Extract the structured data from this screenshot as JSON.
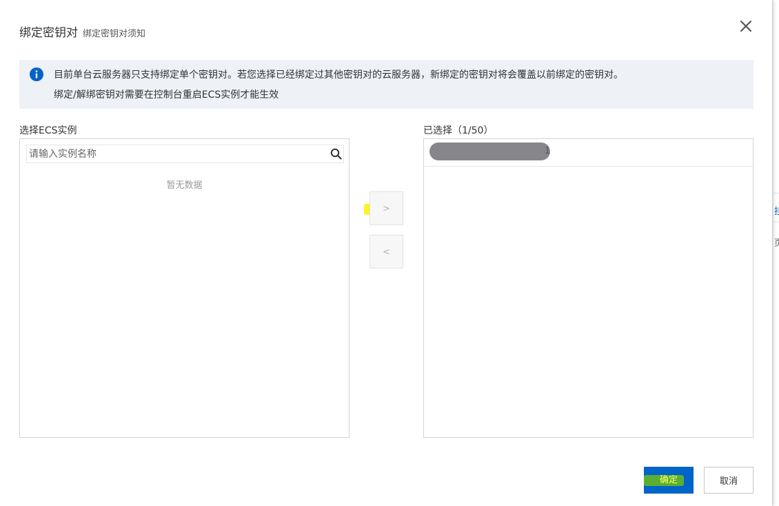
{
  "dialog": {
    "title": "绑定密钥对",
    "subtitle": "绑定密钥对须知"
  },
  "info": {
    "line1": "目前单台云服务器只支持绑定单个密钥对。若您选择已经绑定过其他密钥对的云服务器，新绑定的密钥对将会覆盖以前绑定的密钥对。",
    "line2": "绑定/解绑密钥对需要在控制台重启ECS实例才能生效"
  },
  "left_panel": {
    "title": "选择ECS实例",
    "search_placeholder": "请输入实例名称",
    "empty_text": "暂无数据"
  },
  "right_panel": {
    "title": "已选择（1/50）",
    "items": [
      {
        "tail": "1"
      }
    ]
  },
  "transfer": {
    "to_right_label": ">",
    "to_left_label": "<"
  },
  "footer": {
    "ok_label": "确定",
    "cancel_label": "取消"
  },
  "background": {
    "glyph1": "挂",
    "glyph2": "页"
  },
  "colors": {
    "primary": "#0064c8",
    "info_bg": "#eef1f6",
    "highlight": "#fff200"
  },
  "icons": {
    "close": "close-icon",
    "info": "info-icon",
    "search": "search-icon"
  }
}
